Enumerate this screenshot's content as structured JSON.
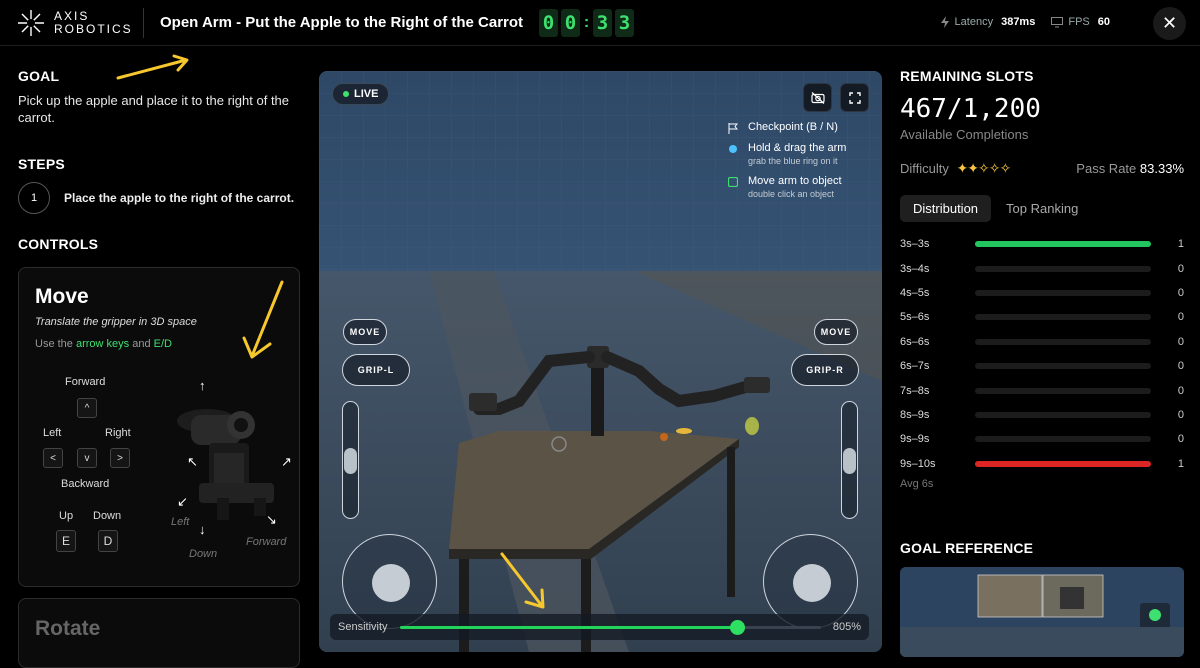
{
  "header": {
    "logo_line1": "AXIS",
    "logo_line2": "ROBOTICS",
    "task_title": "Open Arm - Put the Apple to the Right of the Carrot",
    "timer_digits": [
      "0",
      "0",
      "3",
      "3"
    ],
    "latency_label": "Latency",
    "latency_value": "387ms",
    "fps_label": "FPS",
    "fps_value": "60",
    "close_label": "✕"
  },
  "left": {
    "goal_heading": "GOAL",
    "goal_text": "Pick up the apple and place it to the right of the carrot.",
    "steps_heading": "STEPS",
    "steps": [
      {
        "num": "1",
        "text": "Place the apple to the right of the carrot."
      }
    ],
    "controls_heading": "CONTROLS",
    "move_card": {
      "title": "Move",
      "subtitle": "Translate the gripper in 3D space",
      "use_prefix": "Use the",
      "use_keys1": "arrow keys",
      "use_and": "and",
      "use_keys2": "E/D",
      "forward_label": "Forward",
      "left_label": "Left",
      "right_label": "Right",
      "backward_label": "Backward",
      "up_label": "Up",
      "down_label": "Down",
      "key_up": "^",
      "key_left": "<",
      "key_down": "v",
      "key_right": ">",
      "key_e": "E",
      "key_d": "D",
      "gizmo_left": "Left",
      "gizmo_forward": "Forward",
      "gizmo_down": "Down"
    },
    "rotate_card": {
      "title": "Rotate"
    }
  },
  "viewport": {
    "live_label": "LIVE",
    "hints": [
      {
        "title": "Checkpoint (B / N)",
        "sub": "",
        "icon": "flag-icon"
      },
      {
        "title": "Hold & drag the arm",
        "sub": "grab the blue ring on it",
        "icon": "blue-dot-icon"
      },
      {
        "title": "Move arm to object",
        "sub": "double click an object",
        "icon": "green-square-icon"
      }
    ],
    "left_move": "MOVE",
    "left_grip": "GRIP-L",
    "right_move": "MOVE",
    "right_grip": "GRIP-R",
    "sensitivity_label": "Sensitivity",
    "sensitivity_value": "805%",
    "sensitivity_fraction": 0.8
  },
  "right": {
    "slots_heading": "REMAINING SLOTS",
    "slots_value": "467/1,200",
    "slots_caption": "Available Completions",
    "difficulty_label": "Difficulty",
    "difficulty_stars_filled": 2,
    "difficulty_stars_total": 5,
    "pass_rate_label": "Pass Rate",
    "pass_rate_value": "83.33%",
    "tabs": [
      "Distribution",
      "Top Ranking"
    ],
    "distribution": [
      {
        "label": "3s–3s",
        "count": "1",
        "fill": 1.0,
        "color": "#22c55e"
      },
      {
        "label": "3s–4s",
        "count": "0",
        "fill": 0,
        "color": "#22c55e"
      },
      {
        "label": "4s–5s",
        "count": "0",
        "fill": 0,
        "color": "#22c55e"
      },
      {
        "label": "5s–6s",
        "count": "0",
        "fill": 0,
        "color": "#22c55e"
      },
      {
        "label": "6s–6s",
        "count": "0",
        "fill": 0,
        "color": "#22c55e"
      },
      {
        "label": "6s–7s",
        "count": "0",
        "fill": 0,
        "color": "#22c55e"
      },
      {
        "label": "7s–8s",
        "count": "0",
        "fill": 0,
        "color": "#22c55e"
      },
      {
        "label": "8s–9s",
        "count": "0",
        "fill": 0,
        "color": "#22c55e"
      },
      {
        "label": "9s–9s",
        "count": "0",
        "fill": 0,
        "color": "#22c55e"
      },
      {
        "label": "9s–10s",
        "count": "1",
        "fill": 1.0,
        "color": "#dc2626"
      }
    ],
    "avg_label": "Avg 6s",
    "goal_ref_heading": "GOAL REFERENCE"
  }
}
